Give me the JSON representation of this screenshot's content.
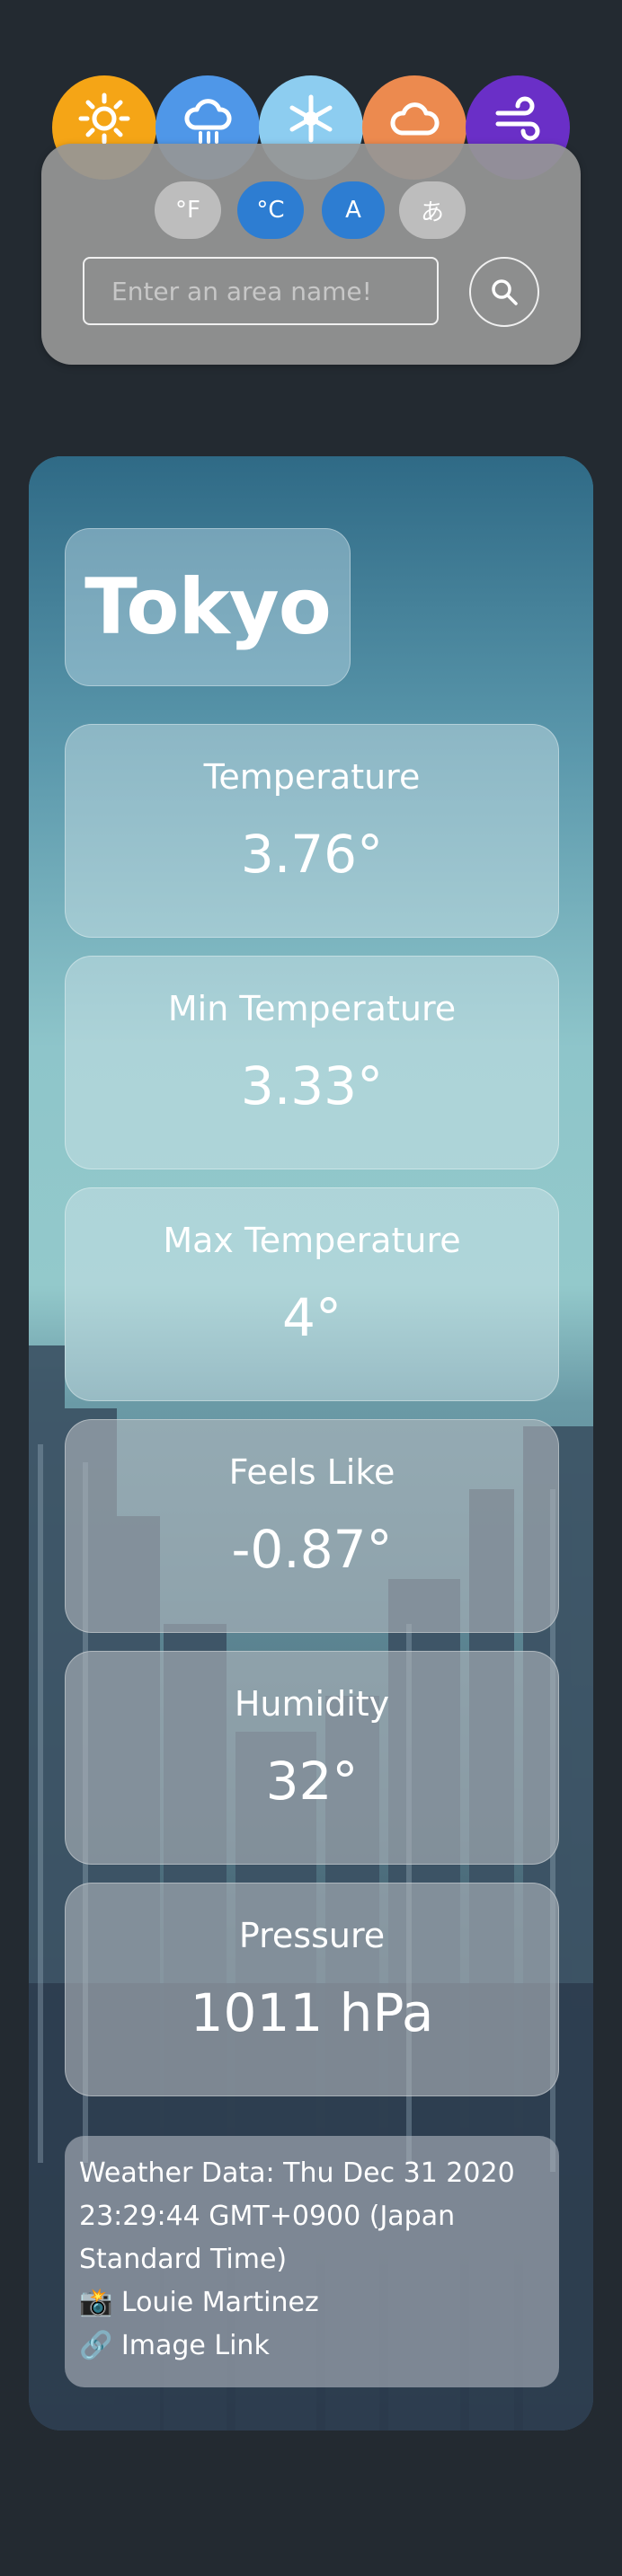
{
  "weather_icons": [
    {
      "name": "sun-icon",
      "color": "#f5a516"
    },
    {
      "name": "rain-cloud-icon",
      "color": "#4f97e8"
    },
    {
      "name": "snowflake-icon",
      "color": "#8dcdf0"
    },
    {
      "name": "cloud-icon",
      "color": "#ec8a4f"
    },
    {
      "name": "wind-icon",
      "color": "#6a2fc7"
    }
  ],
  "controls": {
    "fahrenheit_label": "°F",
    "celsius_label": "°C",
    "english_label": "A",
    "japanese_label": "あ",
    "search_placeholder": "Enter an area name!",
    "search_icon": "search-icon"
  },
  "weather": {
    "city": "Tokyo",
    "stats": [
      {
        "label": "Temperature",
        "value": "3.76°"
      },
      {
        "label": "Min Temperature",
        "value": "3.33°"
      },
      {
        "label": "Max Temperature",
        "value": "4°"
      },
      {
        "label": "Feels Like",
        "value": "-0.87°"
      },
      {
        "label": "Humidity",
        "value": "32°"
      },
      {
        "label": "Pressure",
        "value": "1011 hPa"
      }
    ],
    "footer": {
      "date_line": "Weather Data: Thu Dec 31 2020 23:29:44 GMT+0900 (Japan Standard Time)",
      "photographer": "📸 Louie Martinez",
      "image_link": "🔗 Image Link"
    }
  },
  "colors": {
    "page_background": "#232a31",
    "toggle_active": "#2d7dd2",
    "toggle_inactive": "#bdbdbd"
  }
}
